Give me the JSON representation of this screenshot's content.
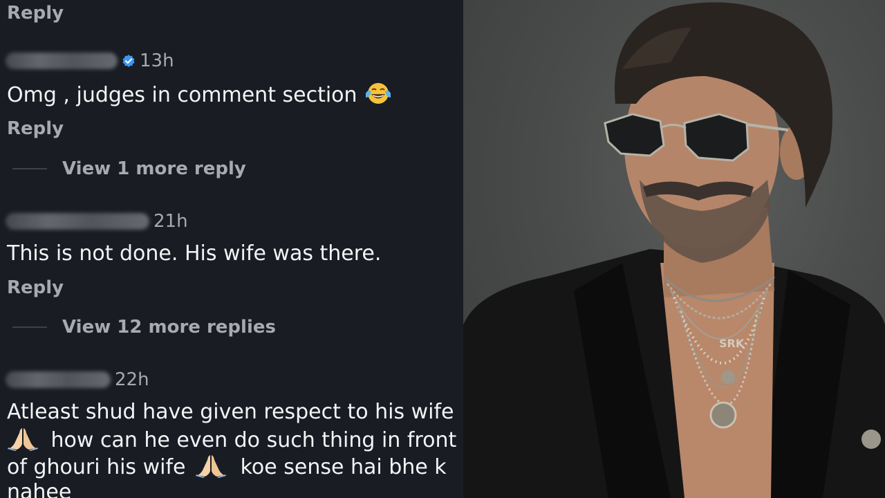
{
  "comments": {
    "top_reply": "Reply",
    "items": [
      {
        "time": "13h",
        "verified": true,
        "text": "Omg , judges in comment section",
        "emoji": "face-with-tears-of-joy-icon",
        "reply": "Reply",
        "view_more": "View 1 more reply"
      },
      {
        "time": "21h",
        "verified": false,
        "text": "This is not done. His wife was there.",
        "reply": "Reply",
        "view_more": "View 12 more replies"
      },
      {
        "time": "22h",
        "verified": false,
        "lines": [
          "Atleast shud have given respect to his wife",
          "how can he even do such thing in front",
          "of ghouri his wife",
          "koe sense hai bhe k",
          "nahee"
        ],
        "emoji": "folded-hands-icon"
      }
    ]
  },
  "colors": {
    "panel_bg": "#191c22",
    "text_primary": "#f3f4f6",
    "text_secondary": "#a7aab0",
    "verified_blue": "#3d97f0"
  },
  "photo": {
    "jewelry_text": "SRK"
  }
}
